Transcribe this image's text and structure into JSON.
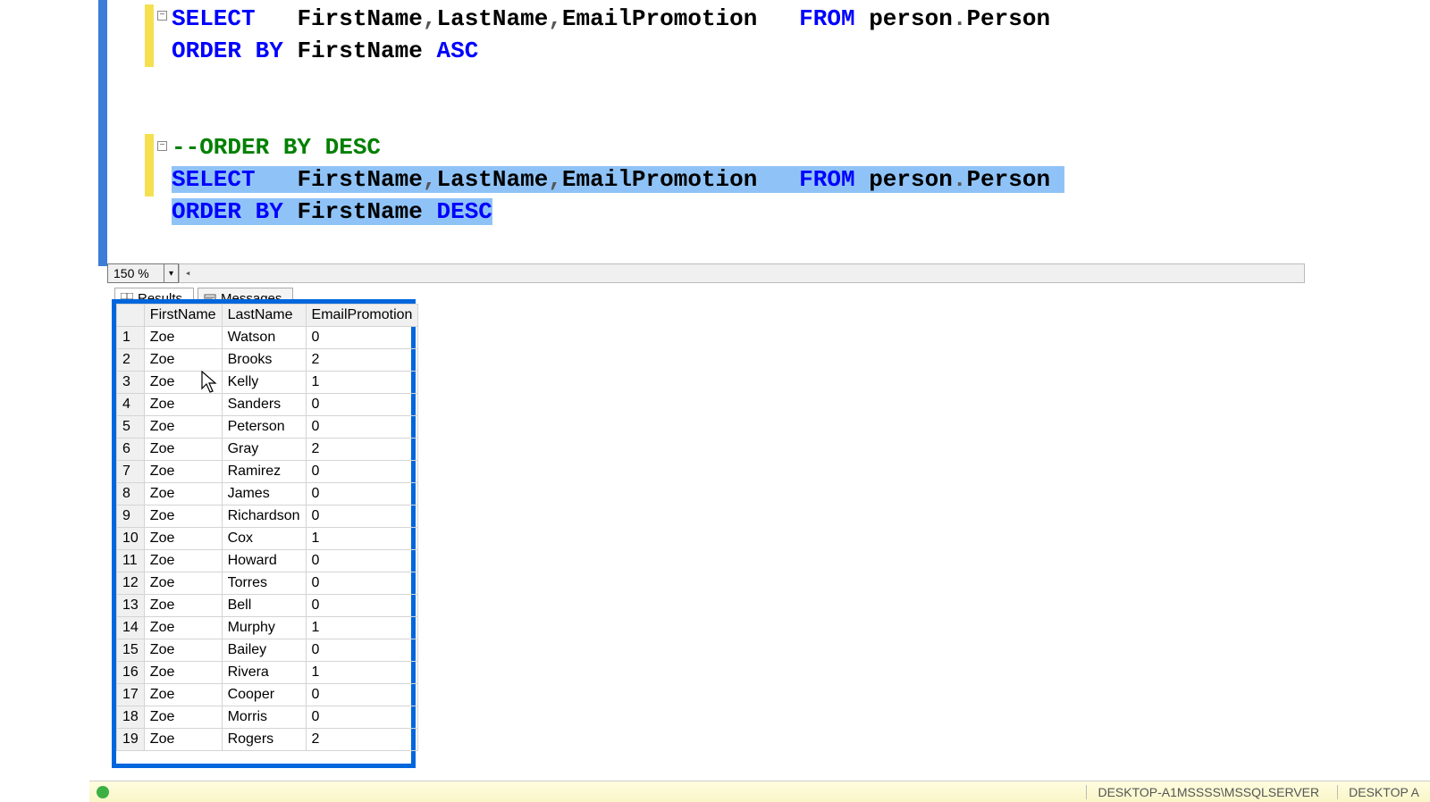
{
  "editor": {
    "zoom": "150 %",
    "fold_glyph": "−",
    "query1": {
      "select": "SELECT",
      "cols_a": "FirstName",
      "cols_b": "LastName",
      "cols_c": "EmailPromotion",
      "from": "FROM",
      "schema": "person",
      "dot": ".",
      "table": "Person",
      "orderby": "ORDER BY",
      "ordercol": "FirstName",
      "dir": "ASC",
      "comma": ","
    },
    "comment": "--ORDER BY DESC",
    "query2": {
      "select": "SELECT",
      "cols_a": "FirstName",
      "cols_b": "LastName",
      "cols_c": "EmailPromotion",
      "from": "FROM",
      "schema": "person",
      "dot": ".",
      "table": "Person",
      "orderby": "ORDER BY",
      "ordercol": "FirstName",
      "dir": "DESC",
      "comma": ","
    }
  },
  "tabs": {
    "results": "Results",
    "messages": "Messages"
  },
  "grid": {
    "headers": {
      "c1": "FirstName",
      "c2": "LastName",
      "c3": "EmailPromotion"
    },
    "rows": [
      {
        "n": "1",
        "fn": "Zoe",
        "ln": "Watson",
        "ep": "0"
      },
      {
        "n": "2",
        "fn": "Zoe",
        "ln": "Brooks",
        "ep": "2"
      },
      {
        "n": "3",
        "fn": "Zoe",
        "ln": "Kelly",
        "ep": "1"
      },
      {
        "n": "4",
        "fn": "Zoe",
        "ln": "Sanders",
        "ep": "0"
      },
      {
        "n": "5",
        "fn": "Zoe",
        "ln": "Peterson",
        "ep": "0"
      },
      {
        "n": "6",
        "fn": "Zoe",
        "ln": "Gray",
        "ep": "2"
      },
      {
        "n": "7",
        "fn": "Zoe",
        "ln": "Ramirez",
        "ep": "0"
      },
      {
        "n": "8",
        "fn": "Zoe",
        "ln": "James",
        "ep": "0"
      },
      {
        "n": "9",
        "fn": "Zoe",
        "ln": "Richardson",
        "ep": "0"
      },
      {
        "n": "10",
        "fn": "Zoe",
        "ln": "Cox",
        "ep": "1"
      },
      {
        "n": "11",
        "fn": "Zoe",
        "ln": "Howard",
        "ep": "0"
      },
      {
        "n": "12",
        "fn": "Zoe",
        "ln": "Torres",
        "ep": "0"
      },
      {
        "n": "13",
        "fn": "Zoe",
        "ln": "Bell",
        "ep": "0"
      },
      {
        "n": "14",
        "fn": "Zoe",
        "ln": "Murphy",
        "ep": "1"
      },
      {
        "n": "15",
        "fn": "Zoe",
        "ln": "Bailey",
        "ep": "0"
      },
      {
        "n": "16",
        "fn": "Zoe",
        "ln": "Rivera",
        "ep": "1"
      },
      {
        "n": "17",
        "fn": "Zoe",
        "ln": "Cooper",
        "ep": "0"
      },
      {
        "n": "18",
        "fn": "Zoe",
        "ln": "Morris",
        "ep": "0"
      },
      {
        "n": "19",
        "fn": "Zoe",
        "ln": "Rogers",
        "ep": "2"
      }
    ]
  },
  "status": {
    "msg": "",
    "server": "DESKTOP-A1MSSSS\\MSSQLSERVER",
    "db": "DESKTOP A"
  }
}
